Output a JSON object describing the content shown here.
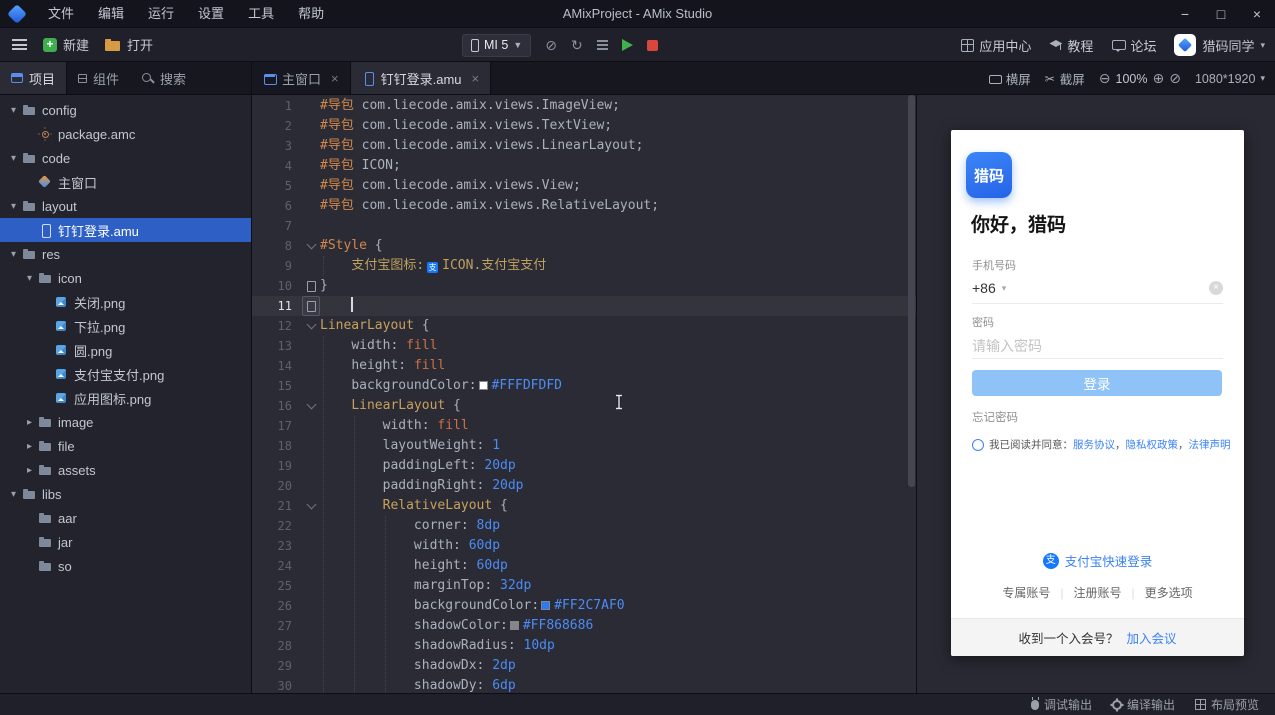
{
  "titlebar": {
    "menus": [
      "文件",
      "编辑",
      "运行",
      "设置",
      "工具",
      "帮助"
    ],
    "title": "AMixProject - AMix Studio",
    "window": {
      "minimize": "−",
      "maximize": "□",
      "close": "×"
    }
  },
  "toolbar": {
    "new_label": "新建",
    "open_label": "打开",
    "device_name": "MI 5",
    "app_center": "应用中心",
    "tutorial": "教程",
    "forum": "论坛",
    "user_name": "猎码同学"
  },
  "panel_tabs": {
    "project": "项目",
    "components": "组件",
    "search": "搜索"
  },
  "editor_tabs": [
    {
      "label": "主窗口",
      "icon": "window",
      "close": "×",
      "active": false
    },
    {
      "label": "钉钉登录.amu",
      "icon": "phone",
      "close": "×",
      "active": true
    }
  ],
  "view_controls": {
    "landscape": "横屏",
    "screenshot": "截屏",
    "zoom": "100%",
    "resolution": "1080*1920"
  },
  "file_tree": [
    {
      "label": "config",
      "type": "folder",
      "level": 0,
      "expanded": true
    },
    {
      "label": "package.amc",
      "type": "amc",
      "level": 1
    },
    {
      "label": "code",
      "type": "folder",
      "level": 0,
      "expanded": true
    },
    {
      "label": "主窗口",
      "type": "amw",
      "level": 1
    },
    {
      "label": "layout",
      "type": "folder",
      "level": 0,
      "expanded": true
    },
    {
      "label": "钉钉登录.amu",
      "type": "amu",
      "level": 1,
      "selected": true
    },
    {
      "label": "res",
      "type": "folder",
      "level": 0,
      "expanded": true
    },
    {
      "label": "icon",
      "type": "folder",
      "level": 1,
      "expanded": true
    },
    {
      "label": "关闭.png",
      "type": "png",
      "level": 2
    },
    {
      "label": "下拉.png",
      "type": "png",
      "level": 2
    },
    {
      "label": "圆.png",
      "type": "png",
      "level": 2
    },
    {
      "label": "支付宝支付.png",
      "type": "png",
      "level": 2
    },
    {
      "label": "应用图标.png",
      "type": "png",
      "level": 2
    },
    {
      "label": "image",
      "type": "folder",
      "level": 1,
      "expanded": false
    },
    {
      "label": "file",
      "type": "folder",
      "level": 1,
      "expanded": false
    },
    {
      "label": "assets",
      "type": "folder",
      "level": 1,
      "expanded": false
    },
    {
      "label": "libs",
      "type": "folder",
      "level": 0,
      "expanded": true
    },
    {
      "label": "aar",
      "type": "folder",
      "level": 1
    },
    {
      "label": "jar",
      "type": "folder",
      "level": 1
    },
    {
      "label": "so",
      "type": "folder",
      "level": 1
    }
  ],
  "code": {
    "lines": [
      {
        "n": 1,
        "tokens": [
          {
            "c": "kw",
            "t": "#导包 "
          },
          {
            "c": "pln",
            "t": "com.liecode.amix.views.ImageView;"
          }
        ]
      },
      {
        "n": 2,
        "tokens": [
          {
            "c": "kw",
            "t": "#导包 "
          },
          {
            "c": "pln",
            "t": "com.liecode.amix.views.TextView;"
          }
        ]
      },
      {
        "n": 3,
        "tokens": [
          {
            "c": "kw",
            "t": "#导包 "
          },
          {
            "c": "pln",
            "t": "com.liecode.amix.views.LinearLayout;"
          }
        ]
      },
      {
        "n": 4,
        "tokens": [
          {
            "c": "kw",
            "t": "#导包 "
          },
          {
            "c": "pln",
            "t": "ICON;"
          }
        ]
      },
      {
        "n": 5,
        "tokens": [
          {
            "c": "kw",
            "t": "#导包 "
          },
          {
            "c": "pln",
            "t": "com.liecode.amix.views.View;"
          }
        ]
      },
      {
        "n": 6,
        "tokens": [
          {
            "c": "kw",
            "t": "#导包 "
          },
          {
            "c": "pln",
            "t": "com.liecode.amix.views.RelativeLayout;"
          }
        ]
      },
      {
        "n": 7,
        "tokens": []
      },
      {
        "n": 8,
        "fold": true,
        "tokens": [
          {
            "c": "kw",
            "t": "#Style"
          },
          {
            "c": "pln",
            "t": " {"
          }
        ]
      },
      {
        "n": 9,
        "tokens": [
          {
            "c": "pln",
            "t": "    "
          },
          {
            "c": "ref",
            "t": "支付宝图标:"
          },
          {
            "icon": true
          },
          {
            "c": "ref",
            "t": "ICON.支付宝支付"
          }
        ]
      },
      {
        "n": 10,
        "mark": true,
        "tokens": [
          {
            "c": "pln",
            "t": "}"
          }
        ]
      },
      {
        "n": 11,
        "current": true,
        "mark": true,
        "caret": true,
        "tokens": []
      },
      {
        "n": 12,
        "fold": true,
        "tokens": [
          {
            "c": "cls",
            "t": "LinearLayout"
          },
          {
            "c": "pln",
            "t": " {"
          }
        ]
      },
      {
        "n": 13,
        "tokens": [
          {
            "c": "pln",
            "t": "    "
          },
          {
            "c": "prop",
            "t": "width:"
          },
          {
            "c": "pln",
            "t": " "
          },
          {
            "c": "val",
            "t": "fill"
          }
        ]
      },
      {
        "n": 14,
        "tokens": [
          {
            "c": "pln",
            "t": "    "
          },
          {
            "c": "prop",
            "t": "height:"
          },
          {
            "c": "pln",
            "t": " "
          },
          {
            "c": "val",
            "t": "fill"
          }
        ]
      },
      {
        "n": 15,
        "tokens": [
          {
            "c": "pln",
            "t": "    "
          },
          {
            "c": "prop",
            "t": "backgroundColor:"
          },
          {
            "swatch": "#FDFDFD"
          },
          {
            "c": "num",
            "t": "#FFFDFDFD"
          }
        ]
      },
      {
        "n": 16,
        "fold": true,
        "tokens": [
          {
            "c": "pln",
            "t": "    "
          },
          {
            "c": "cls",
            "t": "LinearLayout"
          },
          {
            "c": "pln",
            "t": " {"
          }
        ]
      },
      {
        "n": 17,
        "tokens": [
          {
            "c": "pln",
            "t": "        "
          },
          {
            "c": "prop",
            "t": "width:"
          },
          {
            "c": "pln",
            "t": " "
          },
          {
            "c": "val",
            "t": "fill"
          }
        ]
      },
      {
        "n": 18,
        "tokens": [
          {
            "c": "pln",
            "t": "        "
          },
          {
            "c": "prop",
            "t": "layoutWeight:"
          },
          {
            "c": "pln",
            "t": " "
          },
          {
            "c": "num",
            "t": "1"
          }
        ]
      },
      {
        "n": 19,
        "tokens": [
          {
            "c": "pln",
            "t": "        "
          },
          {
            "c": "prop",
            "t": "paddingLeft:"
          },
          {
            "c": "pln",
            "t": " "
          },
          {
            "c": "num",
            "t": "20dp"
          }
        ]
      },
      {
        "n": 20,
        "tokens": [
          {
            "c": "pln",
            "t": "        "
          },
          {
            "c": "prop",
            "t": "paddingRight:"
          },
          {
            "c": "pln",
            "t": " "
          },
          {
            "c": "num",
            "t": "20dp"
          }
        ]
      },
      {
        "n": 21,
        "fold": true,
        "tokens": [
          {
            "c": "pln",
            "t": "        "
          },
          {
            "c": "cls",
            "t": "RelativeLayout"
          },
          {
            "c": "pln",
            "t": " {"
          }
        ]
      },
      {
        "n": 22,
        "tokens": [
          {
            "c": "pln",
            "t": "            "
          },
          {
            "c": "prop",
            "t": "corner:"
          },
          {
            "c": "pln",
            "t": " "
          },
          {
            "c": "num",
            "t": "8dp"
          }
        ]
      },
      {
        "n": 23,
        "tokens": [
          {
            "c": "pln",
            "t": "            "
          },
          {
            "c": "prop",
            "t": "width:"
          },
          {
            "c": "pln",
            "t": " "
          },
          {
            "c": "num",
            "t": "60dp"
          }
        ]
      },
      {
        "n": 24,
        "tokens": [
          {
            "c": "pln",
            "t": "            "
          },
          {
            "c": "prop",
            "t": "height:"
          },
          {
            "c": "pln",
            "t": " "
          },
          {
            "c": "num",
            "t": "60dp"
          }
        ]
      },
      {
        "n": 25,
        "tokens": [
          {
            "c": "pln",
            "t": "            "
          },
          {
            "c": "prop",
            "t": "marginTop:"
          },
          {
            "c": "pln",
            "t": " "
          },
          {
            "c": "num",
            "t": "32dp"
          }
        ]
      },
      {
        "n": 26,
        "tokens": [
          {
            "c": "pln",
            "t": "            "
          },
          {
            "c": "prop",
            "t": "backgroundColor:"
          },
          {
            "swatch": "#2C7AF0"
          },
          {
            "c": "num",
            "t": "#FF2C7AF0"
          }
        ]
      },
      {
        "n": 27,
        "tokens": [
          {
            "c": "pln",
            "t": "            "
          },
          {
            "c": "prop",
            "t": "shadowColor:"
          },
          {
            "swatch": "#868686"
          },
          {
            "c": "num",
            "t": "#FF868686"
          }
        ]
      },
      {
        "n": 28,
        "tokens": [
          {
            "c": "pln",
            "t": "            "
          },
          {
            "c": "prop",
            "t": "shadowRadius:"
          },
          {
            "c": "pln",
            "t": " "
          },
          {
            "c": "num",
            "t": "10dp"
          }
        ]
      },
      {
        "n": 29,
        "tokens": [
          {
            "c": "pln",
            "t": "            "
          },
          {
            "c": "prop",
            "t": "shadowDx:"
          },
          {
            "c": "pln",
            "t": " "
          },
          {
            "c": "num",
            "t": "2dp"
          }
        ]
      },
      {
        "n": 30,
        "tokens": [
          {
            "c": "pln",
            "t": "            "
          },
          {
            "c": "prop",
            "t": "shadowDy:"
          },
          {
            "c": "pln",
            "t": " "
          },
          {
            "c": "num",
            "t": "6dp"
          }
        ]
      }
    ]
  },
  "preview": {
    "app_icon_text": "猎码",
    "greeting": "你好，猎码",
    "phone_label": "手机号码",
    "phone_prefix": "+86",
    "password_label": "密码",
    "password_placeholder": "请输入密码",
    "login_button": "登录",
    "forgot": "忘记密码",
    "agreement_prefix": "我已阅读并同意：",
    "agreement_links": [
      "服务协议",
      "隐私权政策",
      "法律声明"
    ],
    "alipay_icon_text": "支",
    "alipay_login": "支付宝快速登录",
    "account_options": [
      "专属账号",
      "注册账号",
      "更多选项"
    ],
    "meeting_text": "收到一个入会号？",
    "meeting_link": "加入会议"
  },
  "statusbar": {
    "debug": "调试输出",
    "compile": "编译输出",
    "layout_preview": "布局预览"
  },
  "colors": {
    "accent": "#3574F0",
    "tree_selection": "#2D5FC4",
    "run_green": "#43B14B",
    "stop_red": "#D8473C",
    "phone_button": "#8FC2F6"
  }
}
